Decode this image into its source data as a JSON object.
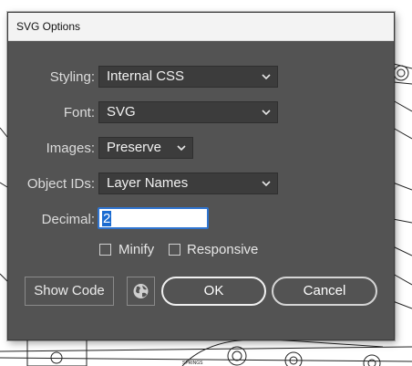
{
  "dialog": {
    "title": "SVG Options",
    "styling": {
      "label": "Styling:",
      "value": "Internal CSS"
    },
    "font": {
      "label": "Font:",
      "value": "SVG"
    },
    "images": {
      "label": "Images:",
      "value": "Preserve"
    },
    "object_ids": {
      "label": "Object IDs:",
      "value": "Layer Names"
    },
    "decimal": {
      "label": "Decimal:",
      "value": "2"
    },
    "minify": {
      "label": "Minify",
      "checked": false
    },
    "responsive": {
      "label": "Responsive",
      "checked": false
    },
    "buttons": {
      "show_code": "Show Code",
      "globe_icon": "globe-icon",
      "ok": "OK",
      "cancel": "Cancel"
    }
  },
  "background": {
    "drawing_text": "SPRINGS"
  },
  "colors": {
    "dialog_bg": "#535353",
    "field_bg": "#3c3c3c",
    "selection": "#1a6bd1",
    "input_focus": "#2f74d0"
  }
}
